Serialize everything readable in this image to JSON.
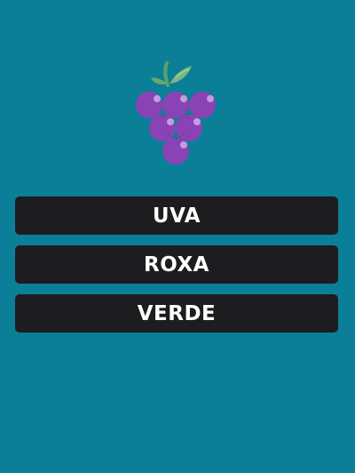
{
  "colors": {
    "background": "#0b7f97",
    "button_background": "#1d1d1f",
    "button_text": "#ffffff",
    "grape_purple": "#8a43b5",
    "grape_highlight": "#c79be0",
    "leaf_green": "#7bb77a",
    "stem_green": "#5f9f66"
  },
  "illustration": {
    "icon": "grape-icon"
  },
  "options": [
    {
      "label": "UVA"
    },
    {
      "label": "ROXA"
    },
    {
      "label": "VERDE"
    }
  ]
}
